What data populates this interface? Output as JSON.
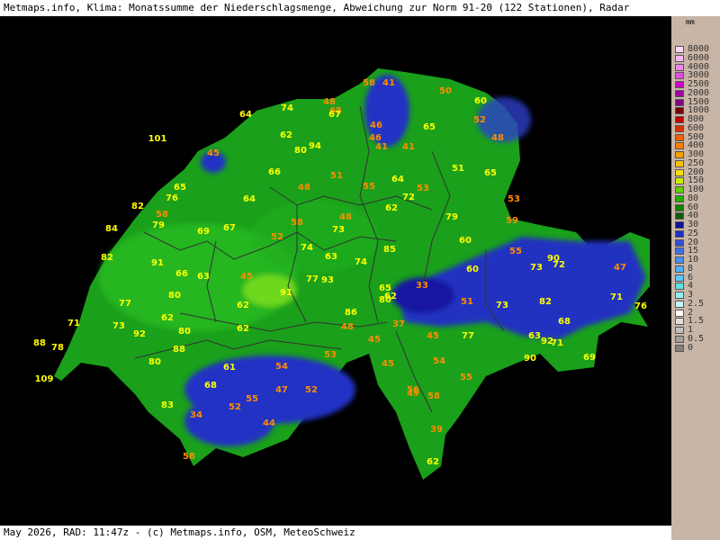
{
  "header": {
    "title": "Metmaps.info, Klima: Monatssumme der Niederschlagsmenge, Abweichung zur Norm 91-20 (122 Stationen), Radar"
  },
  "footer": {
    "text": "May 2026, RAD: 11:47z - (c) Metmaps.info, OSM, MeteoSchweiz"
  },
  "legend": {
    "unit": "mm",
    "items": [
      {
        "label": "8000",
        "color": "#f8d8f8"
      },
      {
        "label": "6000",
        "color": "#f4b8f4"
      },
      {
        "label": "4000",
        "color": "#ee88ee"
      },
      {
        "label": "3000",
        "color": "#e050e0"
      },
      {
        "label": "2500",
        "color": "#cc00cc"
      },
      {
        "label": "2000",
        "color": "#a000a0"
      },
      {
        "label": "1500",
        "color": "#800080"
      },
      {
        "label": "1000",
        "color": "#780000"
      },
      {
        "label": "800",
        "color": "#c00000"
      },
      {
        "label": "600",
        "color": "#e03000"
      },
      {
        "label": "500",
        "color": "#f06000"
      },
      {
        "label": "400",
        "color": "#f88000"
      },
      {
        "label": "300",
        "color": "#f8a000"
      },
      {
        "label": "250",
        "color": "#f8c000"
      },
      {
        "label": "200",
        "color": "#f8e000"
      },
      {
        "label": "150",
        "color": "#c8f000"
      },
      {
        "label": "100",
        "color": "#60d000"
      },
      {
        "label": "80",
        "color": "#20b000"
      },
      {
        "label": "60",
        "color": "#108000"
      },
      {
        "label": "40",
        "color": "#0c5c10"
      },
      {
        "label": "30",
        "color": "#101090"
      },
      {
        "label": "25",
        "color": "#2030c0"
      },
      {
        "label": "20",
        "color": "#3050d8"
      },
      {
        "label": "15",
        "color": "#4070e8"
      },
      {
        "label": "10",
        "color": "#4890f0"
      },
      {
        "label": "8",
        "color": "#50b0f8"
      },
      {
        "label": "6",
        "color": "#58c8f8"
      },
      {
        "label": "4",
        "color": "#60e0e8"
      },
      {
        "label": "3",
        "color": "#90f0f0"
      },
      {
        "label": "2.5",
        "color": "#c0f8f8"
      },
      {
        "label": "2",
        "color": "#ffffff"
      },
      {
        "label": "1.5",
        "color": "#e0e0e0"
      },
      {
        "label": "1",
        "color": "#c0c0c0"
      },
      {
        "label": "0.5",
        "color": "#a0a0a0"
      },
      {
        "label": "0",
        "color": "#808080"
      }
    ]
  },
  "stations": [
    {
      "v": "58",
      "c": "o"
    },
    {
      "v": "41",
      "c": "o"
    },
    {
      "v": "50",
      "c": "o"
    },
    {
      "v": "60",
      "c": "y"
    },
    {
      "v": "74",
      "c": "y"
    },
    {
      "v": "48",
      "c": "o"
    },
    {
      "v": "65",
      "c": "o"
    },
    {
      "v": "67",
      "c": "y"
    },
    {
      "v": "64",
      "c": "y"
    },
    {
      "v": "52",
      "c": "o"
    },
    {
      "v": "62",
      "c": "y"
    },
    {
      "v": "46",
      "c": "o"
    },
    {
      "v": "65",
      "c": "y"
    },
    {
      "v": "101",
      "c": "y"
    },
    {
      "v": "94",
      "c": "y"
    },
    {
      "v": "46",
      "c": "o"
    },
    {
      "v": "48",
      "c": "o"
    },
    {
      "v": "80",
      "c": "y"
    },
    {
      "v": "41",
      "c": "o"
    },
    {
      "v": "41",
      "c": "o"
    },
    {
      "v": "45",
      "c": "o"
    },
    {
      "v": "51",
      "c": "y"
    },
    {
      "v": "66",
      "c": "y"
    },
    {
      "v": "51",
      "c": "o"
    },
    {
      "v": "65",
      "c": "y"
    },
    {
      "v": "48",
      "c": "o"
    },
    {
      "v": "55",
      "c": "o"
    },
    {
      "v": "64",
      "c": "y"
    },
    {
      "v": "53",
      "c": "o"
    },
    {
      "v": "65",
      "c": "y"
    },
    {
      "v": "76",
      "c": "y"
    },
    {
      "v": "72",
      "c": "y"
    },
    {
      "v": "53",
      "c": "o"
    },
    {
      "v": "64",
      "c": "y"
    },
    {
      "v": "82",
      "c": "y"
    },
    {
      "v": "58",
      "c": "o"
    },
    {
      "v": "62",
      "c": "y"
    },
    {
      "v": "79",
      "c": "y"
    },
    {
      "v": "48",
      "c": "o"
    },
    {
      "v": "79",
      "c": "y"
    },
    {
      "v": "58",
      "c": "o"
    },
    {
      "v": "59",
      "c": "o"
    },
    {
      "v": "84",
      "c": "y"
    },
    {
      "v": "69",
      "c": "y"
    },
    {
      "v": "67",
      "c": "y"
    },
    {
      "v": "73",
      "c": "y"
    },
    {
      "v": "52",
      "c": "o"
    },
    {
      "v": "60",
      "c": "y"
    },
    {
      "v": "74",
      "c": "y"
    },
    {
      "v": "85",
      "c": "y"
    },
    {
      "v": "55",
      "c": "o"
    },
    {
      "v": "63",
      "c": "y"
    },
    {
      "v": "82",
      "c": "y"
    },
    {
      "v": "91",
      "c": "y"
    },
    {
      "v": "74",
      "c": "y"
    },
    {
      "v": "90",
      "c": "y"
    },
    {
      "v": "72",
      "c": "y"
    },
    {
      "v": "73",
      "c": "y"
    },
    {
      "v": "47",
      "c": "o"
    },
    {
      "v": "66",
      "c": "y"
    },
    {
      "v": "63",
      "c": "y"
    },
    {
      "v": "60",
      "c": "y"
    },
    {
      "v": "45",
      "c": "o"
    },
    {
      "v": "77",
      "c": "y"
    },
    {
      "v": "93",
      "c": "y"
    },
    {
      "v": "33",
      "c": "o"
    },
    {
      "v": "91",
      "c": "y"
    },
    {
      "v": "80",
      "c": "y"
    },
    {
      "v": "65",
      "c": "y"
    },
    {
      "v": "71",
      "c": "y"
    },
    {
      "v": "77",
      "c": "y"
    },
    {
      "v": "80",
      "c": "y"
    },
    {
      "v": "62",
      "c": "y"
    },
    {
      "v": "82",
      "c": "y"
    },
    {
      "v": "51",
      "c": "o"
    },
    {
      "v": "73",
      "c": "y"
    },
    {
      "v": "62",
      "c": "y"
    },
    {
      "v": "76",
      "c": "y"
    },
    {
      "v": "86",
      "c": "y"
    },
    {
      "v": "62",
      "c": "y"
    },
    {
      "v": "71",
      "c": "y"
    },
    {
      "v": "37",
      "c": "o"
    },
    {
      "v": "68",
      "c": "y"
    },
    {
      "v": "73",
      "c": "y"
    },
    {
      "v": "92",
      "c": "y"
    },
    {
      "v": "80",
      "c": "y"
    },
    {
      "v": "48",
      "c": "o"
    },
    {
      "v": "62",
      "c": "y"
    },
    {
      "v": "45",
      "c": "o"
    },
    {
      "v": "45",
      "c": "o"
    },
    {
      "v": "77",
      "c": "y"
    },
    {
      "v": "63",
      "c": "y"
    },
    {
      "v": "92",
      "c": "y"
    },
    {
      "v": "71",
      "c": "y"
    },
    {
      "v": "88",
      "c": "y"
    },
    {
      "v": "78",
      "c": "y"
    },
    {
      "v": "88",
      "c": "y"
    },
    {
      "v": "53",
      "c": "o"
    },
    {
      "v": "80",
      "c": "y"
    },
    {
      "v": "90",
      "c": "y"
    },
    {
      "v": "69",
      "c": "y"
    },
    {
      "v": "61",
      "c": "y"
    },
    {
      "v": "54",
      "c": "o"
    },
    {
      "v": "45",
      "c": "o"
    },
    {
      "v": "54",
      "c": "o"
    },
    {
      "v": "109",
      "c": "y"
    },
    {
      "v": "68",
      "c": "y"
    },
    {
      "v": "47",
      "c": "o"
    },
    {
      "v": "52",
      "c": "o"
    },
    {
      "v": "56",
      "c": "o"
    },
    {
      "v": "55",
      "c": "o"
    },
    {
      "v": "83",
      "c": "y"
    },
    {
      "v": "55",
      "c": "o"
    },
    {
      "v": "49",
      "c": "o"
    },
    {
      "v": "58",
      "c": "o"
    },
    {
      "v": "52",
      "c": "o"
    },
    {
      "v": "34",
      "c": "o"
    },
    {
      "v": "44",
      "c": "o"
    },
    {
      "v": "39",
      "c": "o"
    },
    {
      "v": "58",
      "c": "o"
    },
    {
      "v": "62",
      "c": "y"
    }
  ],
  "colors": {
    "orange_label": "#ff8c00",
    "yellow_label": "#ffff00",
    "land_green": "#1aa01a",
    "low_precip_blue": "#2333c4",
    "border": "#333333"
  }
}
